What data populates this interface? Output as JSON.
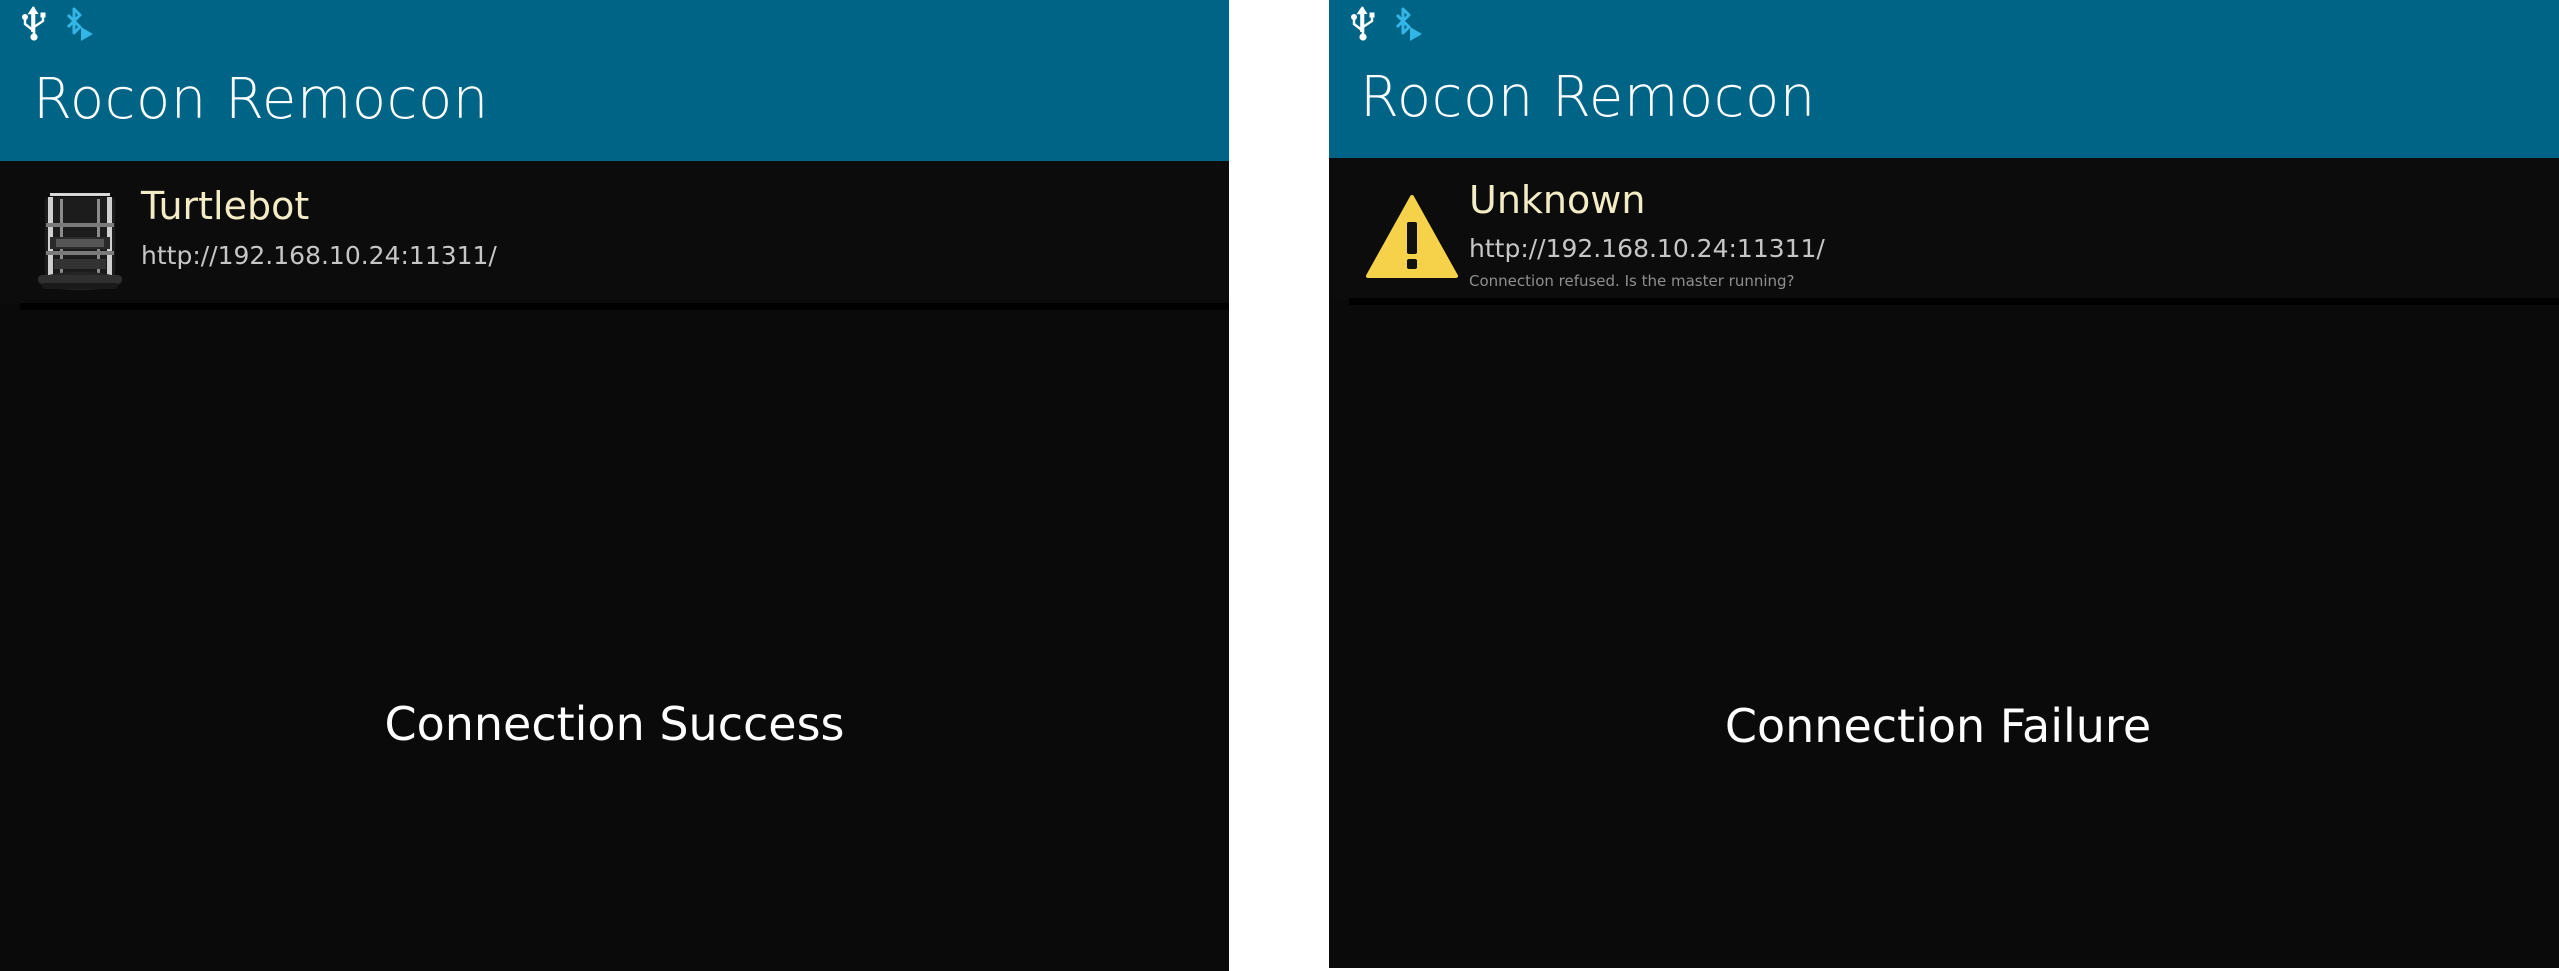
{
  "screens": [
    {
      "app_title": "Rocon Remocon",
      "status_icons": [
        "usb-icon",
        "bluetooth-icon"
      ],
      "item": {
        "icon": "turtlebot-robot-icon",
        "name": "Turtlebot",
        "url": "http://192.168.10.24:11311/",
        "error": ""
      },
      "caption": "Connection Success"
    },
    {
      "app_title": "Rocon Remocon",
      "status_icons": [
        "usb-icon",
        "bluetooth-icon"
      ],
      "item": {
        "icon": "warning-icon",
        "name": "Unknown",
        "url": "http://192.168.10.24:11311/",
        "error": "Connection refused. Is the master running?"
      },
      "caption": "Connection Failure"
    }
  ],
  "colors": {
    "app_bar": "#006487",
    "background": "#0a0a0a",
    "item_name": "#f3ecc4",
    "warning": "#f5d24a",
    "status_accent": "#33b5e5"
  }
}
